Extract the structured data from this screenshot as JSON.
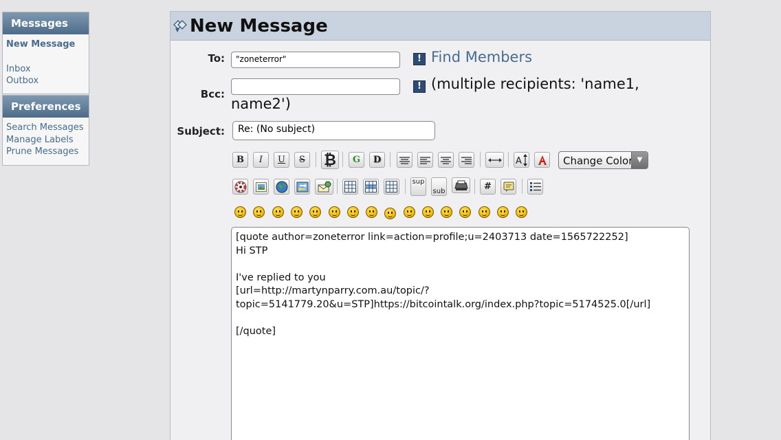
{
  "sidebar": {
    "messages": {
      "title": "Messages",
      "items": [
        {
          "label": "New Message"
        },
        {
          "label": "Inbox"
        },
        {
          "label": "Outbox"
        }
      ]
    },
    "preferences": {
      "title": "Preferences",
      "items": [
        {
          "label": "Search Messages"
        },
        {
          "label": "Manage Labels"
        },
        {
          "label": "Prune Messages"
        }
      ]
    }
  },
  "header": {
    "title": "New Message"
  },
  "form": {
    "to_label": "To:",
    "to_value": "\"zoneterror\"",
    "find_members": "Find Members",
    "bcc_label": "Bcc:",
    "bcc_value": "",
    "bcc_hint": "(multiple recipients: 'name1, name2')",
    "subject_label": "Subject:",
    "subject_value": "Re: (No subject)"
  },
  "toolbar": {
    "bold": "B",
    "italic": "I",
    "underline": "U",
    "strike": "S",
    "bitcoin": "₿",
    "glow": "G",
    "shadow": "D",
    "change_color": "Change Color",
    "sup": "sup",
    "sub": "sub",
    "code": "#"
  },
  "message_body": "[quote author=zoneterror link=action=profile;u=2403713 date=1565722252]\nHi STP\n\nI've replied to you\n[url=http://martynparry.com.au/topic/?topic=5141779.20&u=STP]https://bitcointalk.org/index.php?topic=5174525.0[/url]\n\n[/quote]"
}
